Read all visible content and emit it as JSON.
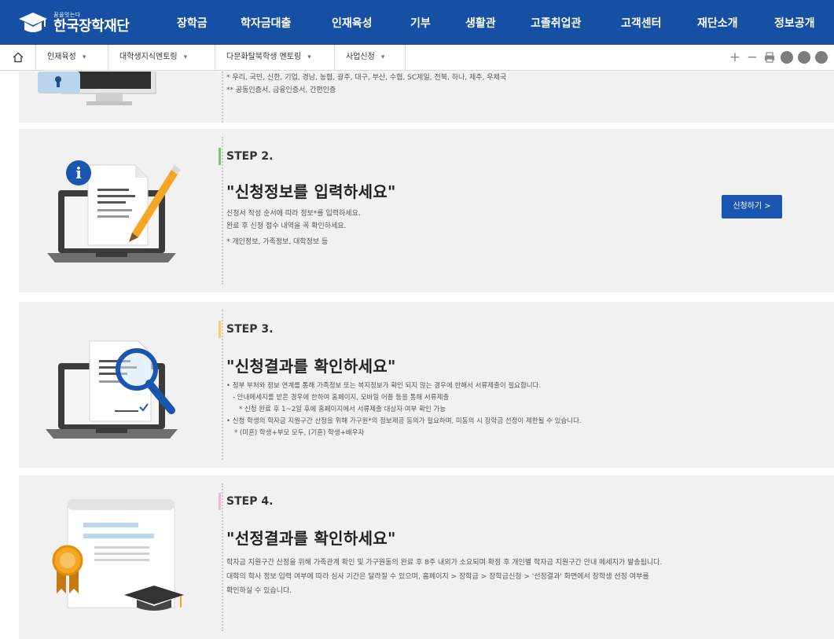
{
  "header": {
    "logo_sub": "꿈을잇는다",
    "logo_main": "한국장학재단",
    "nav": [
      {
        "label": "장학금"
      },
      {
        "label": "학자금대출"
      },
      {
        "label": "인재육성"
      },
      {
        "label": "기부"
      },
      {
        "label": "생활관"
      },
      {
        "label": "고졸취업관"
      },
      {
        "label": "고객센터"
      },
      {
        "label": "재단소개"
      },
      {
        "label": "정보공개"
      }
    ]
  },
  "breadcrumb": {
    "items": [
      {
        "label": "인재육성"
      },
      {
        "label": "대학생지식멘토링"
      },
      {
        "label": "다문화탈북학생 멘토링"
      },
      {
        "label": "사업신청"
      }
    ]
  },
  "colors": {
    "nav_bg": "#1550a5",
    "step2_accent": "#7cc576",
    "step3_accent": "#f5d35a",
    "step4_accent": "#f2b6d6",
    "button": "#1a56b0"
  },
  "step1": {
    "lines": [
      "* 우리, 국민, 신한, 기업, 경남, 농협, 광주, 대구, 부산, 수협, SC제일, 전북, 하나, 제주, 우체국",
      "** 공동인증서, 금융인증서, 간편인증"
    ]
  },
  "step2": {
    "label": "STEP 2.",
    "title": "\"신청정보를 입력하세요\"",
    "lines": [
      "신청서 작성 순서에 따라 정보*를 입력하세요.",
      "완료 후 신청 접수 내역을 꼭 확인하세요.",
      "* 개인정보, 가족정보, 대학정보 등"
    ],
    "button": "신청하기 >"
  },
  "step3": {
    "label": "STEP 3.",
    "title": "\"신청결과를 확인하세요\"",
    "lines": [
      "• 정부 부처와 정보 연계를 통해 가족정보 또는 복지정보가 확인 되지 않는 경우에 한해서 서류제출이 필요합니다.",
      "- 안내메세지를 받은 경우에 한하여 홈페이지, 모바일 어플 등을 통해 서류제출",
      "* 신청 완료 후 1~2일 후에 홈페이지에서 서류제출 대상자 여부 확인 가능",
      "• 신청 학생의 학자금 지원구간 산정을 위해 가구원*의 정보제공 동의가 필요하며, 미동의 시 장학금 선정이 제한될 수 있습니다.",
      "* (미혼) 학생+부모 모두, (기혼) 학생+배우자"
    ]
  },
  "step4": {
    "label": "STEP 4.",
    "title": "\"선정결과를 확인하세요\"",
    "lines": [
      "학자금 지원구간 산정을 위해 가족관계 확인 및 가구원동의 완료 후 8주 내외가 소요되며 확정 후 개인별 학자금 지원구간 안내 메세지가 발송됩니다.",
      "대학의 학사 정보 입력 여부에 따라 심사 기간은 달라질 수 있으며, 홈페이지 > 장학금 > 장학금신청 > '선정결과' 화면에서 장학생 선정 여부를",
      "확인하실 수 있습니다."
    ]
  }
}
